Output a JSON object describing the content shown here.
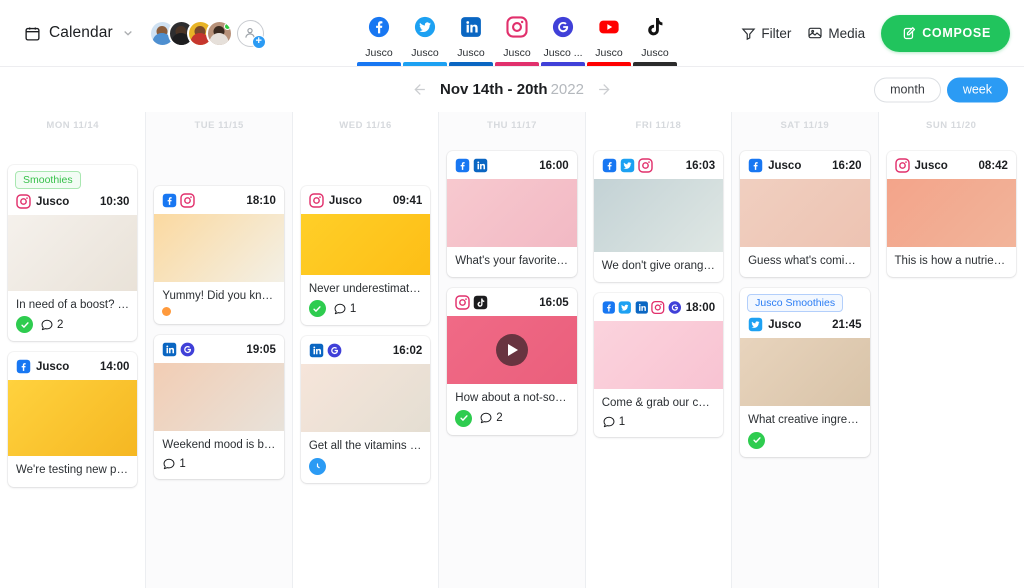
{
  "topbar": {
    "calendar_label": "Calendar",
    "avatar_colors": [
      "#7da9d8",
      "#3a3a3c",
      "#e0b33a",
      "#b98a6a"
    ],
    "filter_label": "Filter",
    "media_label": "Media",
    "compose_label": "COMPOSE",
    "accent_green": "#21c45d"
  },
  "platform_tabs": [
    {
      "icon": "facebook-icon",
      "label": "Jusco",
      "color": "#1877f2",
      "bar": "#1877f2"
    },
    {
      "icon": "twitter-icon",
      "label": "Jusco",
      "color": "#1da1f2",
      "bar": "#1da1f2"
    },
    {
      "icon": "linkedin-icon",
      "label": "Jusco",
      "color": "#0a66c2",
      "bar": "#0a66c2"
    },
    {
      "icon": "instagram-icon",
      "label": "Jusco",
      "color": "#e1306c",
      "bar": "#e1306c"
    },
    {
      "icon": "google-icon",
      "label": "Jusco ...",
      "color": "#4040d8",
      "bar": "#4040d8"
    },
    {
      "icon": "youtube-icon",
      "label": "Jusco",
      "color": "#ff0000",
      "bar": "#ff0000"
    },
    {
      "icon": "tiktok-icon",
      "label": "Jusco",
      "color": "#131313",
      "bar": "#2b2b2b"
    }
  ],
  "subheader": {
    "date_range": "Nov 14th - 20th",
    "year": "2022",
    "prev_label": "previous week",
    "next_label": "next week",
    "view_month": "month",
    "view_week": "week",
    "active_view": "week"
  },
  "columns": [
    {
      "day_label": "MON 11/14",
      "shaded": false,
      "pad": "pad-a",
      "posts": [
        {
          "campaign": "Smoothies",
          "campaign_color": "green",
          "platforms": [
            "instagram-icon"
          ],
          "account": "Jusco",
          "time": "10:30",
          "thumb_height": 76,
          "thumb_from": "#f5f1ec",
          "thumb_to": "#e9e2d8",
          "caption": "In need of a boost? Try o...",
          "status": "approved",
          "comments": "2",
          "video": false,
          "stacked": false
        },
        {
          "campaign": null,
          "campaign_color": null,
          "platforms": [
            "facebook-icon"
          ],
          "account": "Jusco",
          "time": "14:00",
          "thumb_height": 76,
          "thumb_from": "#ffd23e",
          "thumb_to": "#f5b722",
          "caption": "We're testing new pinea...",
          "status": null,
          "comments": null,
          "video": false,
          "stacked": false
        }
      ]
    },
    {
      "day_label": "TUE 11/15",
      "shaded": true,
      "pad": "pad-b",
      "posts": [
        {
          "campaign": null,
          "campaign_color": null,
          "platforms": [
            "facebook-icon",
            "instagram-icon"
          ],
          "account": null,
          "time": "18:10",
          "thumb_height": 68,
          "thumb_from": "#fbd9a0",
          "thumb_to": "#f3f0e6",
          "caption": "Yummy! Did you know th...",
          "status": "pending",
          "comments": null,
          "video": false,
          "stacked": false
        },
        {
          "campaign": null,
          "campaign_color": null,
          "platforms": [
            "linkedin-icon",
            "google-icon"
          ],
          "account": null,
          "time": "19:05",
          "thumb_height": 68,
          "thumb_from": "#f2cdb4",
          "thumb_to": "#e8e2da",
          "caption": "Weekend mood is brunch...",
          "status": null,
          "comments": "1",
          "video": false,
          "stacked": true
        }
      ]
    },
    {
      "day_label": "WED 11/16",
      "shaded": false,
      "pad": "pad-b",
      "posts": [
        {
          "campaign": null,
          "campaign_color": null,
          "platforms": [
            "instagram-icon"
          ],
          "account": "Jusco",
          "time": "09:41",
          "thumb_height": 61,
          "thumb_from": "#ffcf28",
          "thumb_to": "#fdbe16",
          "caption": "Never underestimate the ...",
          "status": "approved",
          "comments": "1",
          "video": false,
          "stacked": false
        },
        {
          "campaign": null,
          "campaign_color": null,
          "platforms": [
            "linkedin-icon",
            "google-icon"
          ],
          "account": null,
          "time": "16:02",
          "thumb_height": 68,
          "thumb_from": "#f6e5da",
          "thumb_to": "#e4ded2",
          "caption": "Get all the vitamins 'cuz ...",
          "status": "scheduled",
          "comments": null,
          "video": false,
          "stacked": true
        }
      ]
    },
    {
      "day_label": "THU 11/17",
      "shaded": true,
      "pad": "pad-d",
      "posts": [
        {
          "campaign": null,
          "campaign_color": null,
          "platforms": [
            "facebook-icon",
            "linkedin-icon"
          ],
          "account": null,
          "time": "16:00",
          "thumb_height": 68,
          "thumb_from": "#f7c9cf",
          "thumb_to": "#f2b9c4",
          "caption": "What's your favorite oran...",
          "status": null,
          "comments": null,
          "video": false,
          "stacked": false
        },
        {
          "campaign": null,
          "campaign_color": null,
          "platforms": [
            "instagram-icon",
            "tiktok-icon"
          ],
          "account": null,
          "time": "16:05",
          "thumb_height": 68,
          "thumb_from": "#f06a86",
          "thumb_to": "#ea5f7c",
          "caption": "How about a not-so-heal...",
          "status": "approved",
          "comments": "2",
          "video": true,
          "stacked": false
        }
      ]
    },
    {
      "day_label": "FRI 11/18",
      "shaded": false,
      "pad": "pad-d",
      "posts": [
        {
          "campaign": null,
          "campaign_color": null,
          "platforms": [
            "facebook-icon",
            "twitter-icon",
            "instagram-icon"
          ],
          "account": null,
          "time": "16:03",
          "thumb_height": 73,
          "thumb_from": "#c3d2d5",
          "thumb_to": "#dfe7e4",
          "caption": "We don't give oranges e...",
          "status": null,
          "comments": null,
          "video": false,
          "stacked": false
        },
        {
          "campaign": null,
          "campaign_color": null,
          "platforms": [
            "facebook-icon",
            "twitter-icon",
            "linkedin-icon",
            "instagram-icon",
            "google-icon"
          ],
          "account": null,
          "time": "18:00",
          "thumb_height": 68,
          "thumb_from": "#fbd3dd",
          "thumb_to": "#f8c3d2",
          "caption": "Come & grab our cocktail...",
          "status": null,
          "comments": "1",
          "video": false,
          "stacked": false
        }
      ]
    },
    {
      "day_label": "SAT 11/19",
      "shaded": true,
      "pad": "pad-d",
      "posts": [
        {
          "campaign": null,
          "campaign_color": null,
          "platforms": [
            "facebook-icon"
          ],
          "account": "Jusco",
          "time": "16:20",
          "thumb_height": 68,
          "thumb_from": "#f0cfc0",
          "thumb_to": "#edc3b2",
          "caption": "Guess what's coming to ...",
          "status": null,
          "comments": null,
          "video": false,
          "stacked": false
        },
        {
          "campaign": "Jusco Smoothies",
          "campaign_color": "blue",
          "platforms": [
            "twitter-icon"
          ],
          "account": "Jusco",
          "time": "21:45",
          "thumb_height": 68,
          "thumb_from": "#e8d4bd",
          "thumb_to": "#d8c3a8",
          "caption": "What creative ingredient...",
          "status": "approved",
          "comments": null,
          "video": false,
          "stacked": false
        }
      ]
    },
    {
      "day_label": "SUN 11/20",
      "shaded": false,
      "pad": "pad-d",
      "posts": [
        {
          "campaign": null,
          "campaign_color": null,
          "platforms": [
            "instagram-icon"
          ],
          "account": "Jusco",
          "time": "08:42",
          "thumb_height": 68,
          "thumb_from": "#f3a48a",
          "thumb_to": "#f2b49a",
          "caption": "This is how a nutrient po...",
          "status": null,
          "comments": null,
          "video": false,
          "stacked": false
        }
      ]
    }
  ]
}
